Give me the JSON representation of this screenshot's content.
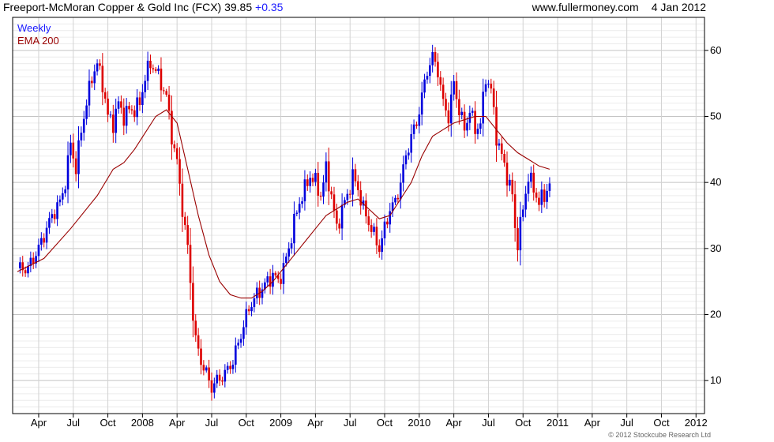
{
  "header": {
    "title": "Freeport-McMoran Copper & Gold Inc (FCX) 39.85",
    "change": "+0.35",
    "site": "www.fullermoney.com",
    "date": "4 Jan 2012"
  },
  "legend": {
    "weekly": "Weekly",
    "ema": "EMA 200"
  },
  "copyright": "© 2012 Stockcube Research Ltd",
  "colors": {
    "up": "#0000dd",
    "down": "#dd0000",
    "ema": "#990000",
    "grid": "#d8d8d8",
    "axis": "#000000"
  },
  "chart_data": {
    "type": "candlestick-bar",
    "series": [
      {
        "name": "Weekly",
        "kind": "weekly price bars (up = blue, down = red)",
        "values": [
          [
            0,
            27
          ],
          [
            4,
            27
          ],
          [
            8,
            30
          ],
          [
            11,
            33
          ],
          [
            13,
            35
          ],
          [
            16,
            37
          ],
          [
            18,
            40
          ],
          [
            20,
            46
          ],
          [
            22,
            42
          ],
          [
            24,
            48
          ],
          [
            26,
            52
          ],
          [
            28,
            56
          ],
          [
            30,
            58
          ],
          [
            32,
            55
          ],
          [
            34,
            50
          ],
          [
            36,
            49
          ],
          [
            38,
            52
          ],
          [
            40,
            50
          ],
          [
            42,
            51
          ],
          [
            44,
            51
          ],
          [
            46,
            52
          ],
          [
            48,
            56
          ],
          [
            50,
            58
          ],
          [
            52,
            57
          ],
          [
            54,
            55
          ],
          [
            56,
            53
          ],
          [
            58,
            47
          ],
          [
            60,
            43
          ],
          [
            62,
            36
          ],
          [
            64,
            30
          ],
          [
            65,
            25
          ],
          [
            66,
            20
          ],
          [
            67,
            16
          ],
          [
            69,
            13
          ],
          [
            71,
            11
          ],
          [
            73,
            9
          ],
          [
            75,
            10
          ],
          [
            78,
            11
          ],
          [
            81,
            13
          ],
          [
            84,
            17
          ],
          [
            87,
            21
          ],
          [
            90,
            23
          ],
          [
            92,
            24
          ],
          [
            94,
            25
          ],
          [
            96,
            26
          ],
          [
            98,
            25
          ],
          [
            100,
            27
          ],
          [
            102,
            30
          ],
          [
            104,
            34
          ],
          [
            106,
            37
          ],
          [
            108,
            39
          ],
          [
            110,
            41
          ],
          [
            112,
            40
          ],
          [
            114,
            38
          ],
          [
            116,
            42
          ],
          [
            118,
            38
          ],
          [
            120,
            33
          ],
          [
            122,
            36
          ],
          [
            124,
            38
          ],
          [
            126,
            41
          ],
          [
            128,
            39
          ],
          [
            130,
            36
          ],
          [
            132,
            34
          ],
          [
            134,
            32
          ],
          [
            136,
            30
          ],
          [
            138,
            33
          ],
          [
            140,
            36
          ],
          [
            142,
            37
          ],
          [
            144,
            40
          ],
          [
            146,
            44
          ],
          [
            148,
            47
          ],
          [
            150,
            49
          ],
          [
            152,
            53
          ],
          [
            154,
            57
          ],
          [
            156,
            59
          ],
          [
            158,
            57
          ],
          [
            160,
            52
          ],
          [
            162,
            50
          ],
          [
            164,
            55
          ],
          [
            166,
            51
          ],
          [
            168,
            48
          ],
          [
            170,
            51
          ],
          [
            172,
            48
          ],
          [
            174,
            49
          ],
          [
            176,
            56
          ],
          [
            178,
            54
          ],
          [
            180,
            47
          ],
          [
            182,
            44
          ],
          [
            184,
            41
          ],
          [
            186,
            38
          ],
          [
            187,
            33
          ],
          [
            188,
            31
          ],
          [
            190,
            36
          ],
          [
            192,
            41
          ],
          [
            194,
            39
          ],
          [
            196,
            37
          ],
          [
            198,
            38
          ],
          [
            200,
            39.85
          ]
        ]
      },
      {
        "name": "EMA 200",
        "kind": "line",
        "values": [
          [
            0,
            26.5
          ],
          [
            10,
            28.5
          ],
          [
            20,
            33
          ],
          [
            30,
            38
          ],
          [
            36,
            42
          ],
          [
            40,
            43
          ],
          [
            44,
            45
          ],
          [
            48,
            47.5
          ],
          [
            52,
            50
          ],
          [
            56,
            51
          ],
          [
            60,
            49
          ],
          [
            64,
            42
          ],
          [
            68,
            35
          ],
          [
            72,
            29
          ],
          [
            76,
            25
          ],
          [
            80,
            23
          ],
          [
            84,
            22.5
          ],
          [
            88,
            22.5
          ],
          [
            92,
            23.5
          ],
          [
            96,
            25
          ],
          [
            100,
            27
          ],
          [
            104,
            29
          ],
          [
            108,
            31
          ],
          [
            112,
            33
          ],
          [
            116,
            35
          ],
          [
            120,
            36
          ],
          [
            124,
            37
          ],
          [
            128,
            37.5
          ],
          [
            132,
            36
          ],
          [
            136,
            34.5
          ],
          [
            140,
            35
          ],
          [
            144,
            37.5
          ],
          [
            148,
            40
          ],
          [
            152,
            44
          ],
          [
            156,
            47
          ],
          [
            160,
            48
          ],
          [
            164,
            49
          ],
          [
            168,
            49.5
          ],
          [
            172,
            50
          ],
          [
            176,
            50
          ],
          [
            180,
            48
          ],
          [
            184,
            46
          ],
          [
            188,
            44.5
          ],
          [
            192,
            43.5
          ],
          [
            196,
            42.5
          ],
          [
            200,
            42
          ]
        ]
      }
    ],
    "x_ticks": [
      {
        "w": 8,
        "label": "Apr"
      },
      {
        "w": 21,
        "label": "Jul"
      },
      {
        "w": 34,
        "label": "Oct"
      },
      {
        "w": 47,
        "label": "2008"
      },
      {
        "w": 60,
        "label": "Apr"
      },
      {
        "w": 73,
        "label": "Jul"
      },
      {
        "w": 86,
        "label": "Oct"
      },
      {
        "w": 99,
        "label": "2009"
      },
      {
        "w": 112,
        "label": "Apr"
      },
      {
        "w": 125,
        "label": "Jul"
      },
      {
        "w": 138,
        "label": "Oct"
      },
      {
        "w": 151,
        "label": "2010"
      },
      {
        "w": 164,
        "label": "Apr"
      },
      {
        "w": 177,
        "label": "Jul"
      },
      {
        "w": 190,
        "label": "Oct"
      },
      {
        "w": 203,
        "label": "2011"
      },
      {
        "w": 216,
        "label": "Apr"
      },
      {
        "w": 229,
        "label": "Jul"
      },
      {
        "w": 242,
        "label": "Oct"
      },
      {
        "w": 255,
        "label": "2012"
      }
    ],
    "y_ticks": [
      10,
      20,
      30,
      40,
      50,
      60
    ],
    "ylim": [
      5,
      65
    ],
    "xlim": [
      0,
      257
    ],
    "grid": true,
    "legend_position": "top-left"
  }
}
